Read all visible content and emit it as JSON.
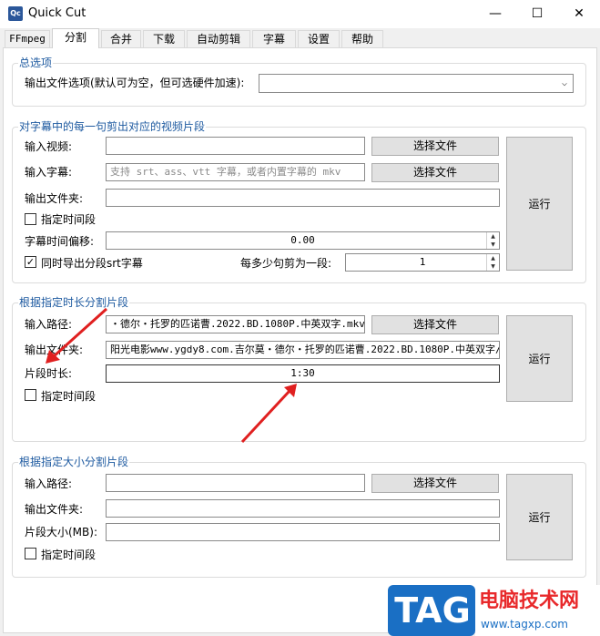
{
  "window": {
    "title": "Quick Cut",
    "icon_text": "Qc",
    "minimize": "—",
    "maximize": "☐",
    "close": "✕"
  },
  "tabs": [
    "FFmpeg",
    "分割",
    "合并",
    "下载",
    "自动剪辑",
    "字幕",
    "设置",
    "帮助"
  ],
  "general": {
    "title": "总选项",
    "output_options_label": "输出文件选项(默认可为空，但可选硬件加速):",
    "output_options_value": ""
  },
  "subtitle_split": {
    "title": "对字幕中的每一句剪出对应的视频片段",
    "input_video_label": "输入视频:",
    "input_video_value": "",
    "input_subtitle_label": "输入字幕:",
    "input_subtitle_placeholder": "支持 srt、ass、vtt 字幕，或者内置字幕的 mkv",
    "output_folder_label": "输出文件夹:",
    "output_folder_value": "",
    "choose_file_1": "选择文件",
    "choose_file_2": "选择文件",
    "time_range_label": "指定时间段",
    "time_range_checked": false,
    "offset_label": "字幕时间偏移:",
    "offset_value": "0.00",
    "export_srt_label": "同时导出分段srt字幕",
    "export_srt_checked": true,
    "every_n_label": "每多少句剪为一段:",
    "every_n_value": "1",
    "run": "运行"
  },
  "duration_split": {
    "title": "根据指定时长分割片段",
    "input_path_label": "输入路径:",
    "input_path_value": "・德尔・托罗的匹诺曹.2022.BD.1080P.中英双字.mkv",
    "choose_file": "选择文件",
    "output_folder_label": "输出文件夹:",
    "output_folder_value": "阳光电影www.ygdy8.com.吉尔莫・德尔・托罗的匹诺曹.2022.BD.1080P.中英双字/",
    "segment_duration_label": "片段时长:",
    "segment_duration_value": "1:30",
    "time_range_label": "指定时间段",
    "time_range_checked": false,
    "run": "运行"
  },
  "size_split": {
    "title": "根据指定大小分割片段",
    "input_path_label": "输入路径:",
    "input_path_value": "",
    "choose_file": "选择文件",
    "output_folder_label": "输出文件夹:",
    "output_folder_value": "",
    "segment_size_label": "片段大小(MB):",
    "segment_size_value": "",
    "time_range_label": "指定时间段",
    "time_range_checked": false,
    "run": "运行"
  },
  "watermark": {
    "logo": "TAG",
    "site_name": "电脑技术网",
    "url": "www.tagxp.com"
  },
  "colors": {
    "group_title": "#1e5aa0",
    "arrow": "#e02020",
    "watermark_blue": "#1a6fc4",
    "watermark_red": "#e8292b"
  }
}
